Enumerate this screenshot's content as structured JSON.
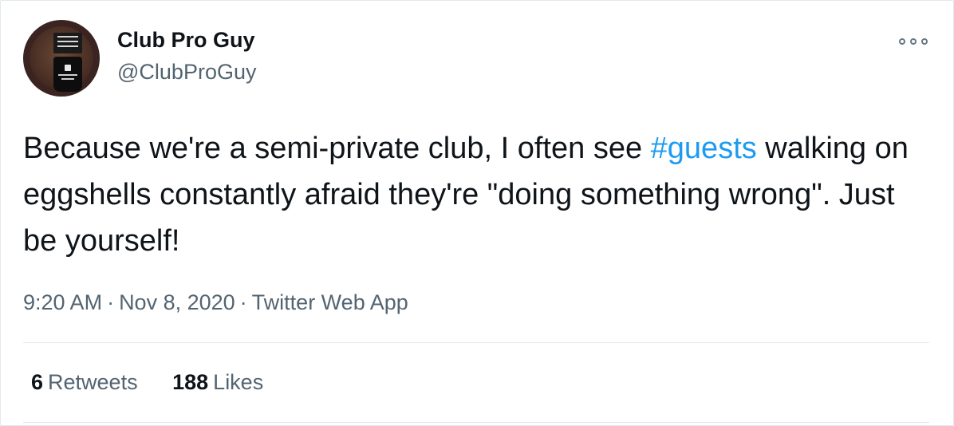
{
  "tweet": {
    "author": {
      "name": "Club Pro Guy",
      "handle": "@ClubProGuy",
      "avatar_icon": "avatar-photo"
    },
    "text_before": "Because we're a semi-private club, I often see ",
    "hashtag": "#guests",
    "text_after": " walking on eggshells constantly afraid they're \"doing something wrong\". Just be yourself!",
    "time": "9:20 AM",
    "separator": "·",
    "date": "Nov 8, 2020",
    "source": "Twitter Web App",
    "stats": {
      "retweets_count": "6",
      "retweets_label": "Retweets",
      "likes_count": "188",
      "likes_label": "Likes"
    }
  },
  "colors": {
    "link": "#1d9bf0",
    "secondary_text": "#536471",
    "primary_text": "#0f1419",
    "divider": "#e1e8ed"
  },
  "icons": {
    "more": "more-options-icon"
  }
}
